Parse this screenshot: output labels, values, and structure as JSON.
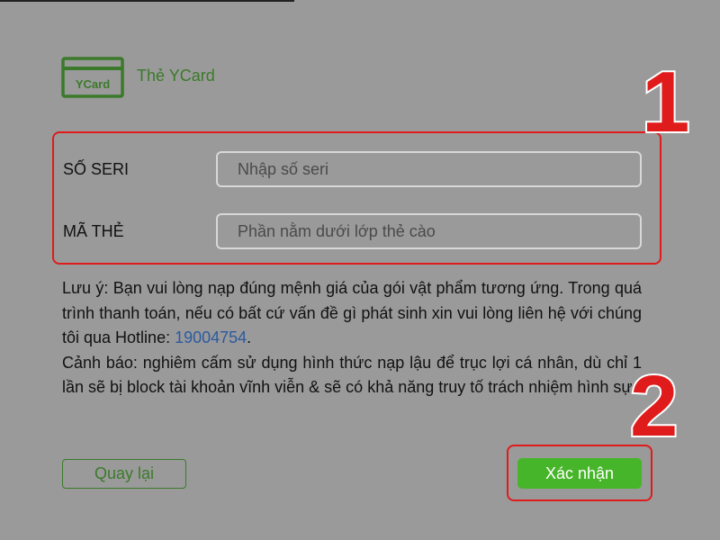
{
  "card": {
    "logo_text": "YCard",
    "title": "Thẻ YCard"
  },
  "form": {
    "serial_label": "SỐ SERI",
    "serial_placeholder": "Nhập số seri",
    "serial_value": "",
    "code_label": "MÃ THẺ",
    "code_placeholder": "Phần nằm dưới lớp thẻ cào",
    "code_value": ""
  },
  "notes": {
    "note_text": "Lưu ý: Bạn vui lòng nạp đúng mệnh giá của gói vật phẩm tương ứng. Trong quá trình thanh toán, nếu có bất cứ vấn đề gì phát sinh xin vui lòng liên hệ với chúng tôi qua Hotline: ",
    "hotline": "19004754",
    "note_end": ".",
    "warning_text": "Cảnh báo: nghiêm cấm sử dụng hình thức nạp lậu để trục lợi cá nhân, dù chỉ 1 lần sẽ bị block tài khoản vĩnh viễn & sẽ có khả năng truy tố trách nhiệm hình sự."
  },
  "buttons": {
    "back_label": "Quay lại",
    "confirm_label": "Xác nhận"
  },
  "annotations": {
    "step1": "1",
    "step2": "2"
  },
  "colors": {
    "background": "#9a9a9a",
    "brand_green": "#3b7a2a",
    "confirm_green": "#47b52a",
    "highlight_red": "#e01b1b",
    "hotline_blue": "#2c5aa0"
  }
}
